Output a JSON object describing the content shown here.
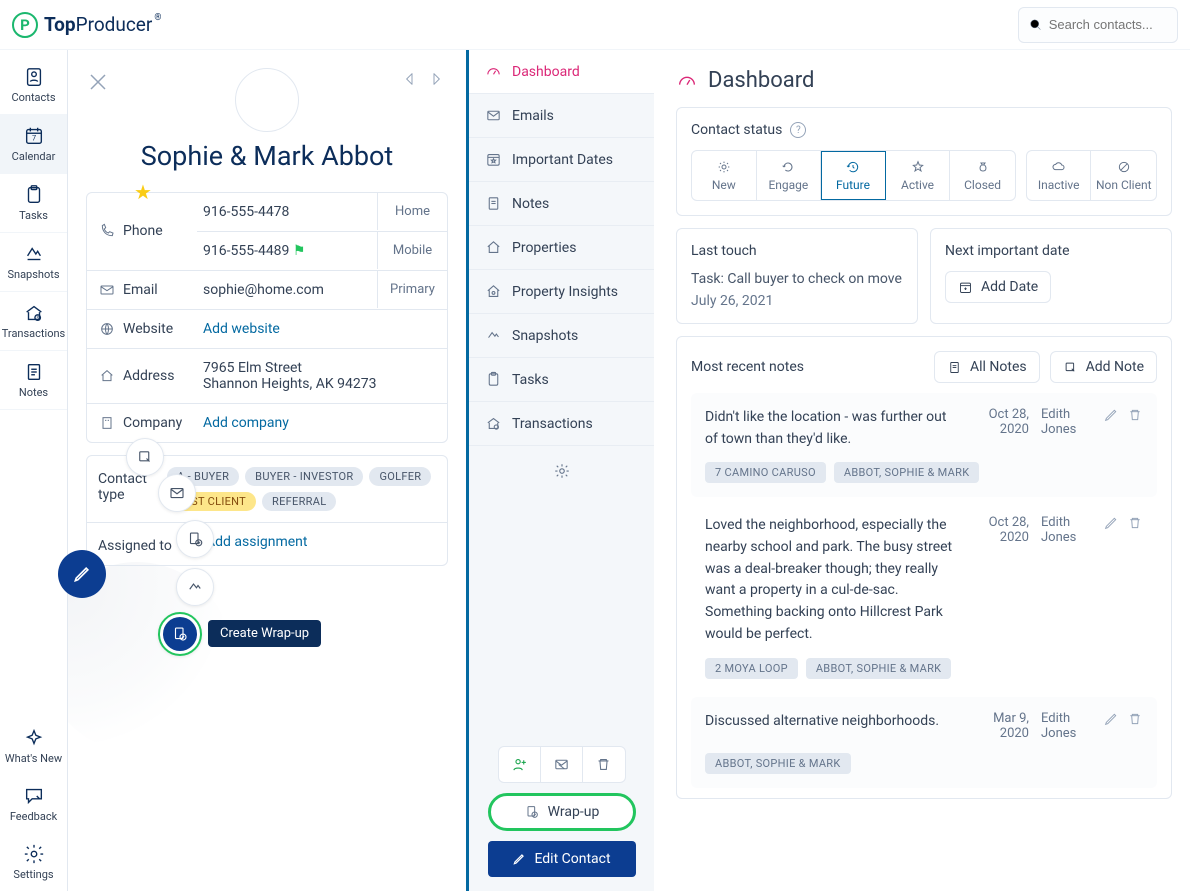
{
  "brand": {
    "name1": "Top",
    "name2": "Producer"
  },
  "search": {
    "placeholder": "Search contacts..."
  },
  "leftnav": {
    "items": [
      {
        "label": "Contacts"
      },
      {
        "label": "Calendar",
        "badge": "7"
      },
      {
        "label": "Tasks"
      },
      {
        "label": "Snapshots"
      },
      {
        "label": "Transactions"
      },
      {
        "label": "Notes"
      }
    ],
    "bottom": [
      {
        "label": "What's New"
      },
      {
        "label": "Feedback"
      },
      {
        "label": "Settings"
      }
    ]
  },
  "contact": {
    "name": "Sophie & Mark Abbot",
    "phone": [
      {
        "value": "916-555-4478",
        "type": "Home"
      },
      {
        "value": "916-555-4489",
        "type": "Mobile",
        "flagged": true
      }
    ],
    "email": {
      "value": "sophie@home.com",
      "type": "Primary"
    },
    "website": {
      "placeholder": "Add website"
    },
    "address": {
      "line1": "7965 Elm Street",
      "line2": "Shannon Heights, AK 94273"
    },
    "company": {
      "placeholder": "Add company"
    },
    "labels": {
      "phone": "Phone",
      "email": "Email",
      "website": "Website",
      "address": "Address",
      "company": "Company"
    },
    "types": {
      "label": "Contact type",
      "pills": [
        "A - BUYER",
        "BUYER - INVESTOR",
        "GOLFER",
        "PAST CLIENT",
        "REFERRAL"
      ],
      "highlighted": "PAST CLIENT"
    },
    "assigned": {
      "label": "Assigned to",
      "placeholder": "Add assignment"
    }
  },
  "fab": {
    "tooltip": "Create Wrap-up"
  },
  "tabs": [
    "Dashboard",
    "Emails",
    "Important Dates",
    "Notes",
    "Properties",
    "Property Insights",
    "Snapshots",
    "Tasks",
    "Transactions"
  ],
  "tabs_active": "Dashboard",
  "tabs_buttons": {
    "wrapup": "Wrap-up",
    "edit": "Edit Contact"
  },
  "dashboard": {
    "title": "Dashboard",
    "status": {
      "label": "Contact status",
      "group1": [
        "New",
        "Engage",
        "Future",
        "Active",
        "Closed"
      ],
      "group2": [
        "Inactive",
        "Non Client"
      ],
      "selected": "Future"
    },
    "last_touch": {
      "label": "Last touch",
      "task": "Task: Call buyer to check on move",
      "date": "July 26, 2021"
    },
    "next_date": {
      "label": "Next important date",
      "button": "Add Date"
    },
    "notes": {
      "label": "Most recent notes",
      "all_btn": "All Notes",
      "add_btn": "Add Note",
      "items": [
        {
          "text": "Didn't like the location - was further out of town than they'd like.",
          "date": "Oct 28, 2020",
          "author": "Edith Jones",
          "tags": [
            "7 CAMINO CARUSO",
            "ABBOT, SOPHIE & MARK"
          ]
        },
        {
          "text": "Loved the neighborhood, especially the nearby school and park. The busy street was a deal-breaker though; they really want a property in a cul-de-sac. Something backing onto Hillcrest Park would be perfect.",
          "date": "Oct 28, 2020",
          "author": "Edith Jones",
          "tags": [
            "2 MOYA LOOP",
            "ABBOT, SOPHIE & MARK"
          ]
        },
        {
          "text": "Discussed alternative neighborhoods.",
          "date": "Mar 9, 2020",
          "author": "Edith Jones",
          "tags": [
            "ABBOT, SOPHIE & MARK"
          ]
        }
      ]
    }
  }
}
